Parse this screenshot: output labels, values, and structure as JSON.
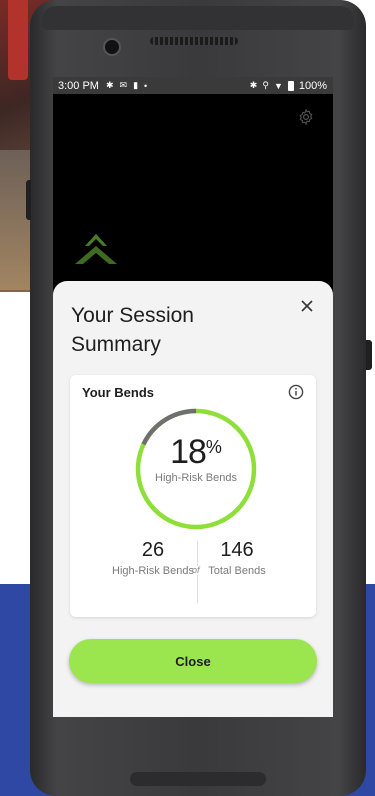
{
  "status_bar": {
    "time": "3:00 PM",
    "battery": "100%"
  },
  "sheet": {
    "title": "Your Session Summary",
    "close_icon": "close-icon"
  },
  "card": {
    "title": "Your Bends",
    "info_icon": "info-icon",
    "percent_value": "18",
    "percent_symbol": "%",
    "percent_fraction": 0.18,
    "percent_label": "High-Risk Bends",
    "high_risk_count": "26",
    "high_risk_label": "High-Risk Bends",
    "of_text": "of",
    "total_count": "146",
    "total_label": "Total Bends"
  },
  "actions": {
    "close_label": "Close"
  },
  "colors": {
    "accent_green": "#9be54f",
    "ring_track": "#6f6f6f",
    "ring_progress": "#8fdf3a"
  },
  "icons": {
    "settings": "gear-icon",
    "logo": "chevron-up-logo"
  }
}
